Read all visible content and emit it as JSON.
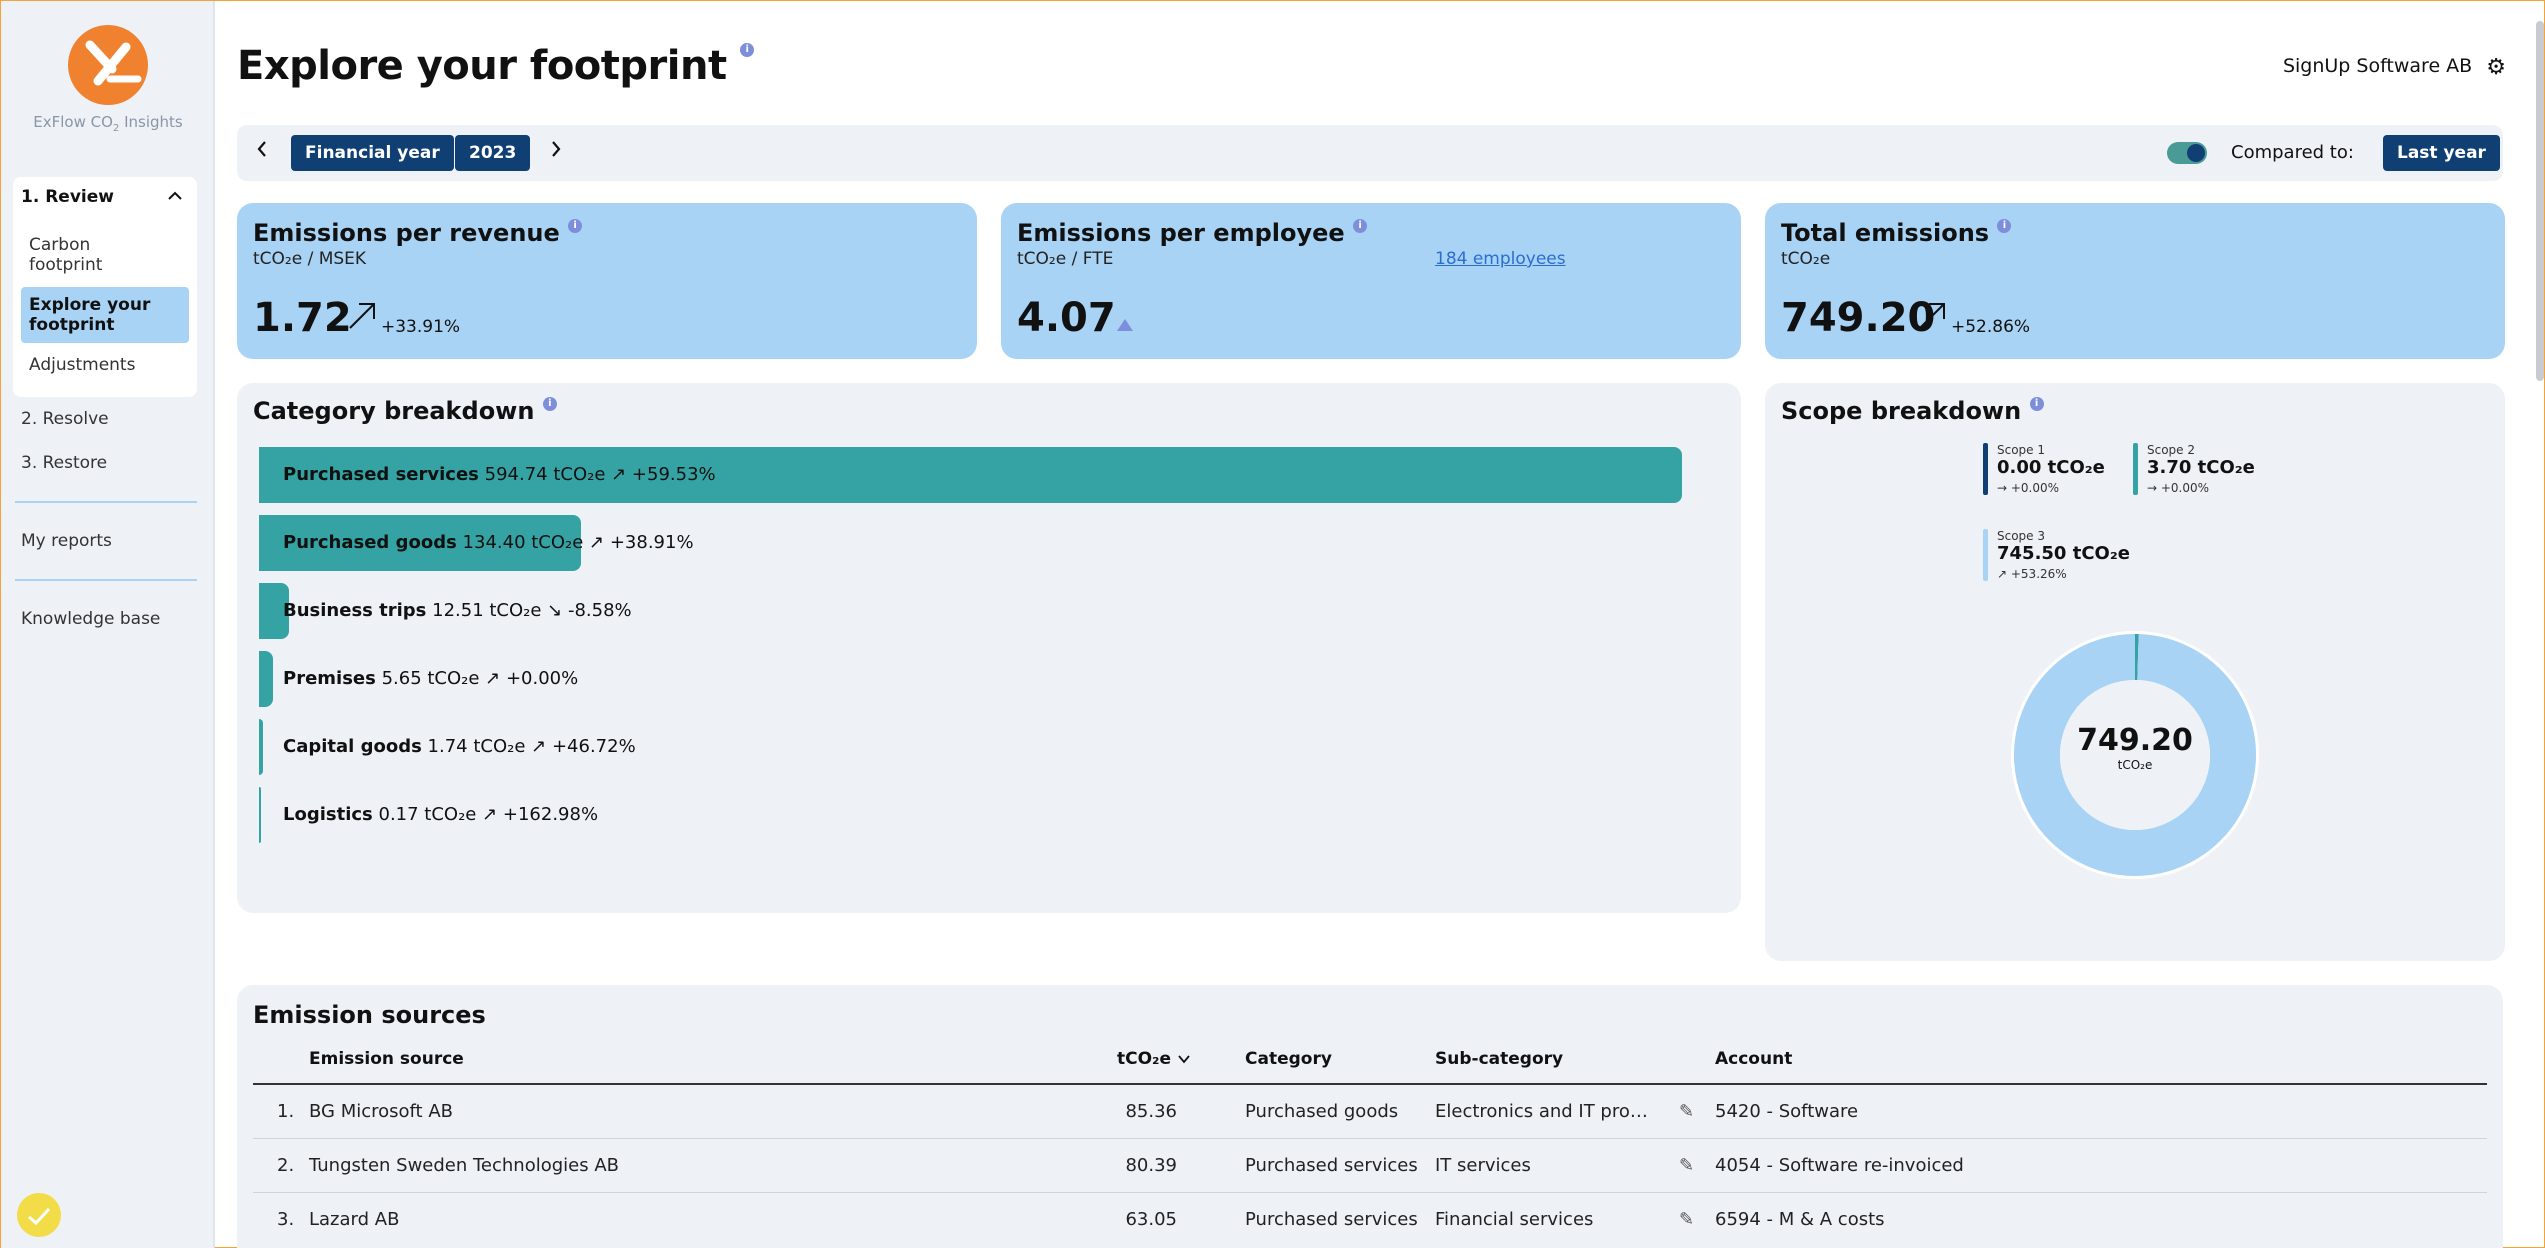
{
  "app": {
    "logo_text": "ExFlow CO",
    "logo_sub": "2",
    "logo_text2": " Insights"
  },
  "sidebar": {
    "review": {
      "label": "1. Review",
      "items": [
        "Carbon footprint",
        "Explore your footprint",
        "Adjustments"
      ]
    },
    "resolve": "2. Resolve",
    "restore": "3. Restore",
    "reports": "My reports",
    "kb": "Knowledge base"
  },
  "header": {
    "title": "Explore your footprint",
    "company": "SignUp Software AB"
  },
  "filter": {
    "period_type": "Financial year",
    "year": "2023",
    "compared_label": "Compared to:",
    "compared_value": "Last year",
    "compare_enabled": true
  },
  "kpis": [
    {
      "title": "Emissions per revenue",
      "unit": "tCO₂e / MSEK",
      "value": "1.72",
      "change": "+33.91%"
    },
    {
      "title": "Emissions per employee",
      "unit": "tCO₂e / FTE",
      "value": "4.07",
      "link": "184 employees"
    },
    {
      "title": "Total emissions",
      "unit": "tCO₂e",
      "value": "749.20",
      "change": "+52.86%"
    }
  ],
  "category_breakdown": {
    "title": "Category breakdown"
  },
  "chart_data": {
    "type": "bar",
    "orientation": "horizontal",
    "categories": [
      "Purchased services",
      "Purchased goods",
      "Business trips",
      "Premises",
      "Capital goods",
      "Logistics"
    ],
    "values": [
      594.74,
      134.4,
      12.51,
      5.65,
      1.74,
      0.17
    ],
    "changes": [
      "+59.53%",
      "+38.91%",
      "-8.58%",
      "+0.00%",
      "+46.72%",
      "+162.98%"
    ],
    "unit": "tCO₂e",
    "xlim": [
      0,
      600
    ],
    "xticks": [
      "0",
      "200",
      "400",
      "600"
    ]
  },
  "scope_breakdown": {
    "title": "Scope breakdown",
    "total": "749.20",
    "total_unit": "tCO₂e",
    "scopes": [
      {
        "name": "Scope 1",
        "value": "0.00 tCO₂e",
        "change": "+0.00%",
        "num": 0.0,
        "color": "#0f3f73"
      },
      {
        "name": "Scope 2",
        "value": "3.70 tCO₂e",
        "change": "+0.00%",
        "num": 3.7,
        "color": "#35a3a3"
      },
      {
        "name": "Scope 3",
        "value": "745.50 tCO₂e",
        "change": "+53.26%",
        "num": 745.5,
        "color": "#a8d3f5"
      }
    ]
  },
  "emission_sources": {
    "title": "Emission sources",
    "columns": [
      "Emission source",
      "tCO₂e",
      "Category",
      "Sub-category",
      "Account"
    ],
    "rows": [
      {
        "n": "1.",
        "source": "BG Microsoft AB",
        "value": "85.36",
        "category": "Purchased goods",
        "sub": "Electronics and IT pro…",
        "account": "5420 - Software"
      },
      {
        "n": "2.",
        "source": "Tungsten Sweden Technologies AB",
        "value": "80.39",
        "category": "Purchased services",
        "sub": "IT services",
        "account": "4054 - Software re-invoiced"
      },
      {
        "n": "3.",
        "source": "Lazard AB",
        "value": "63.05",
        "category": "Purchased services",
        "sub": "Financial services",
        "account": "6594 - M & A costs"
      }
    ]
  }
}
